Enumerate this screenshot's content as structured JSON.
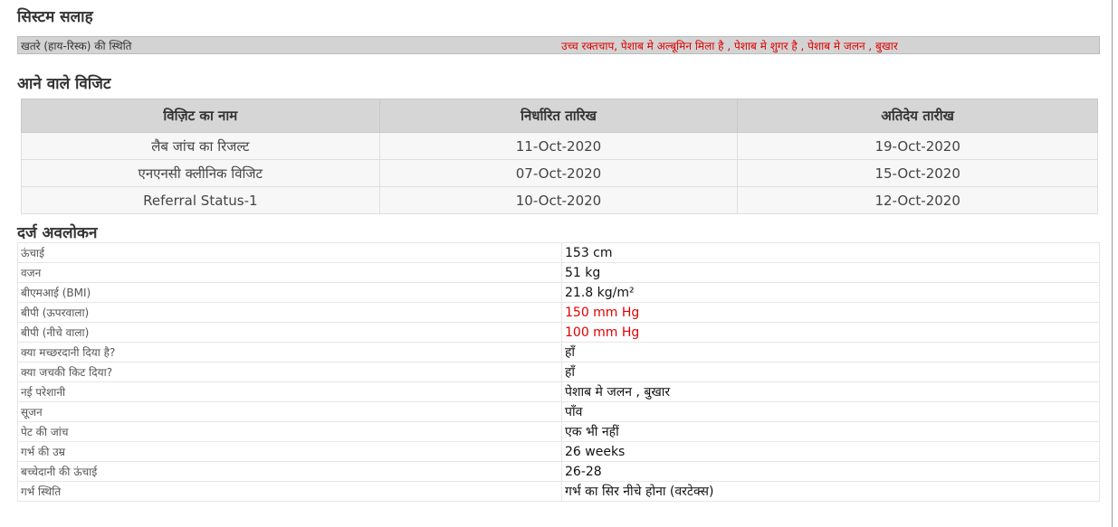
{
  "advice": {
    "title": "सिस्टम सलाह",
    "label": "खतरे (हाय-रिस्क) की स्थिति",
    "value": "उच्च रक्तचाप, पेशाब मे अल्बूमिन मिला है , पेशाब मे शुगर है , पेशाब मे जलन , बुखार",
    "value_color": "#e00000"
  },
  "visits": {
    "title": "आने वाले विजिट",
    "headers": [
      "विज़िट का नाम",
      "निर्धारित तारिख",
      "अतिदेय तारीख"
    ],
    "rows": [
      [
        "लैब जांच का रिजल्ट",
        "11-Oct-2020",
        "19-Oct-2020"
      ],
      [
        "एनएनसी क्लीनिक विजिट",
        "07-Oct-2020",
        "15-Oct-2020"
      ],
      [
        "Referral Status-1",
        "10-Oct-2020",
        "12-Oct-2020"
      ]
    ]
  },
  "observations": {
    "title": "दर्ज अवलोकन",
    "rows": [
      {
        "label": "ऊंचाई",
        "value": "153 cm",
        "alert": false
      },
      {
        "label": "वजन",
        "value": "51 kg",
        "alert": false
      },
      {
        "label": "बीएमआई (BMI)",
        "value": "21.8 kg/m²",
        "alert": false
      },
      {
        "label": "बीपी (ऊपरवाला)",
        "value": "150 mm Hg",
        "alert": true
      },
      {
        "label": "बीपी (नीचे वाला)",
        "value": "100 mm Hg",
        "alert": true
      },
      {
        "label": "क्या मच्छरदानी दिया है?",
        "value": "हाँ",
        "alert": false
      },
      {
        "label": "क्या जचकी किट दिया?",
        "value": "हाँ",
        "alert": false
      },
      {
        "label": "नई परेशानी",
        "value": "पेशाब मे जलन , बुखार",
        "alert": false
      },
      {
        "label": "सूजन",
        "value": "पाँव",
        "alert": false
      },
      {
        "label": "पेट की जांच",
        "value": "एक भी नहीं",
        "alert": false
      },
      {
        "label": "गर्भ की उम्र",
        "value": "26 weeks",
        "alert": false
      },
      {
        "label": "बच्चेदानी की ऊंचाई",
        "value": "26-28",
        "alert": false
      },
      {
        "label": "गर्भ स्थिति",
        "value": "गर्भ का सिर नीचे होना (वरटेक्स)",
        "alert": false
      }
    ],
    "alert_color": "#e00000"
  }
}
